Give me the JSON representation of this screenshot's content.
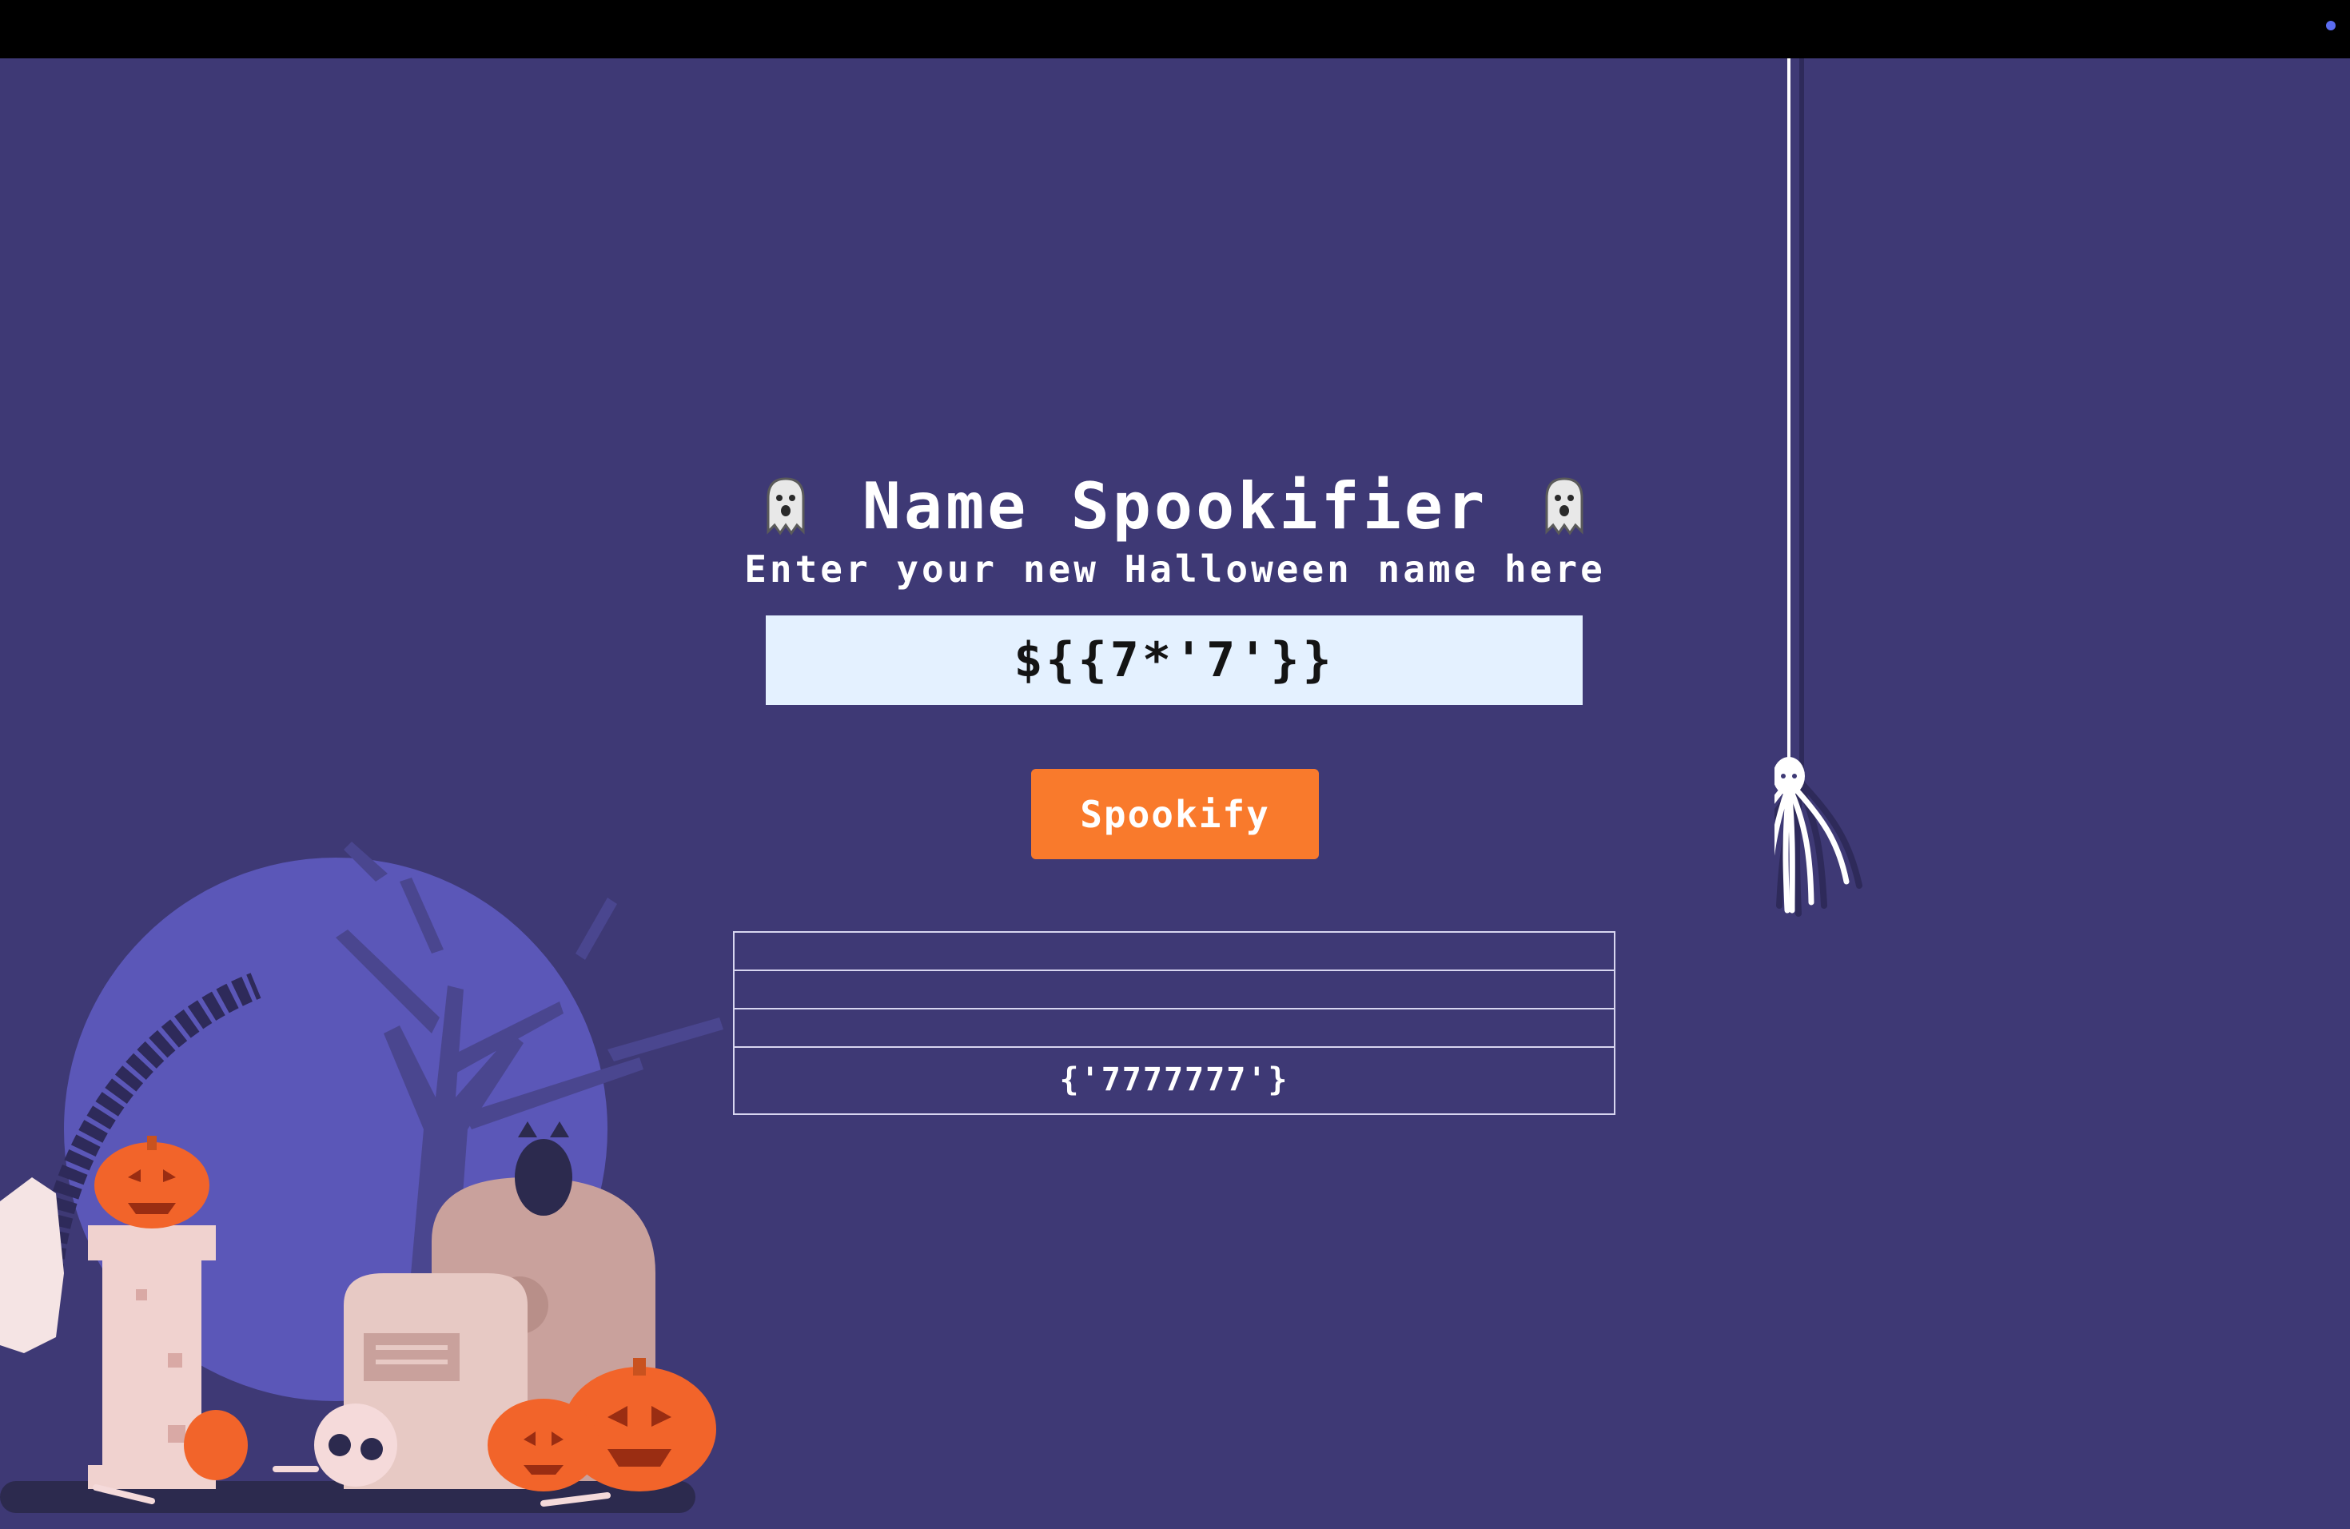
{
  "title": "Name Spookifier",
  "subtitle": "Enter your new Halloween name here",
  "input": {
    "value": "${{7*'7'}}"
  },
  "button": {
    "label": "Spookify"
  },
  "results": [
    "",
    "",
    "",
    "{'7777777'}"
  ],
  "colors": {
    "background": "#3e3975",
    "input_bg": "#e4f1ff",
    "button_bg": "#f97a2c",
    "moon": "#5b57b8",
    "pumpkin": "#f2642a"
  },
  "icons": [
    "ghost-icon",
    "spider-icon",
    "pumpkin-icon",
    "skull-icon",
    "tombstone-icon",
    "owl-icon",
    "bone-icon"
  ]
}
